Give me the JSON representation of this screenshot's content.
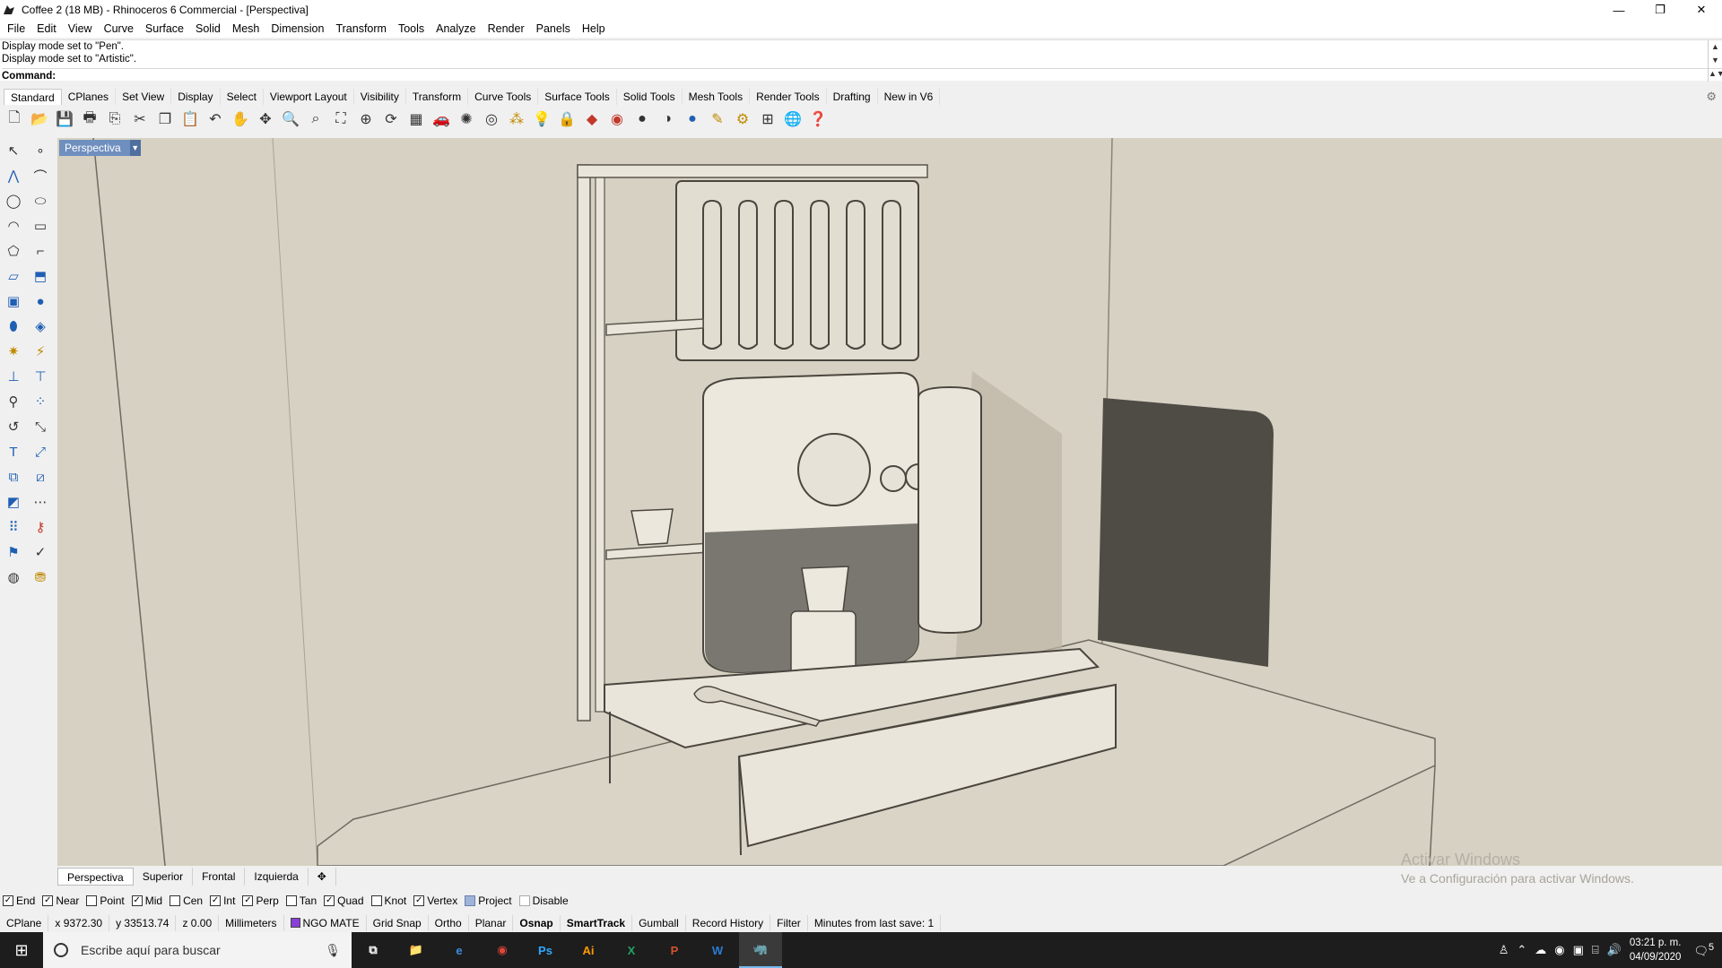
{
  "window": {
    "title": "Coffee 2 (18 MB) - Rhinoceros 6 Commercial - [Perspectiva]",
    "controls": {
      "minimize": "—",
      "restore": "❐",
      "close": "✕"
    }
  },
  "menu": [
    "File",
    "Edit",
    "View",
    "Curve",
    "Surface",
    "Solid",
    "Mesh",
    "Dimension",
    "Transform",
    "Tools",
    "Analyze",
    "Render",
    "Panels",
    "Help"
  ],
  "history": {
    "line1": "Display mode set to \"Pen\".",
    "line2": "Display mode set to \"Artistic\".",
    "command_label": "Command:"
  },
  "toolbar_tabs": [
    "Standard",
    "CPlanes",
    "Set View",
    "Display",
    "Select",
    "Viewport Layout",
    "Visibility",
    "Transform",
    "Curve Tools",
    "Surface Tools",
    "Solid Tools",
    "Mesh Tools",
    "Render Tools",
    "Drafting",
    "New in V6"
  ],
  "viewport": {
    "active_label": "Perspectiva",
    "tabs": [
      "Perspectiva",
      "Superior",
      "Frontal",
      "Izquierda"
    ],
    "add_tab": "✥",
    "watermark_title": "Activar Windows",
    "watermark_sub": "Ve a Configuración para activar Windows."
  },
  "osnaps": [
    {
      "label": "End",
      "checked": true
    },
    {
      "label": "Near",
      "checked": true
    },
    {
      "label": "Point",
      "checked": false
    },
    {
      "label": "Mid",
      "checked": true
    },
    {
      "label": "Cen",
      "checked": false
    },
    {
      "label": "Int",
      "checked": true
    },
    {
      "label": "Perp",
      "checked": true
    },
    {
      "label": "Tan",
      "checked": false
    },
    {
      "label": "Quad",
      "checked": true
    },
    {
      "label": "Knot",
      "checked": false
    },
    {
      "label": "Vertex",
      "checked": true
    },
    {
      "label": "Project",
      "checked": false
    },
    {
      "label": "Disable",
      "checked": false
    }
  ],
  "status": {
    "cplane": "CPlane",
    "x": "x 9372.30",
    "y": "y 33513.74",
    "z": "z 0.00",
    "units": "Millimeters",
    "layer": "NGO MATE",
    "layer_color": "#8a3fd6",
    "grid_snap": "Grid Snap",
    "ortho": "Ortho",
    "planar": "Planar",
    "osnap": "Osnap",
    "smarttrack": "SmartTrack",
    "gumball": "Gumball",
    "record_history": "Record History",
    "filter": "Filter",
    "minutes": "Minutes from last save: 1"
  },
  "taskbar": {
    "search_placeholder": "Escribe aquí para buscar",
    "apps": [
      "Ps",
      "Ai",
      "X",
      "P",
      "W"
    ],
    "time": "03:21 p. m.",
    "date": "04/09/2020",
    "notifications": "5"
  }
}
